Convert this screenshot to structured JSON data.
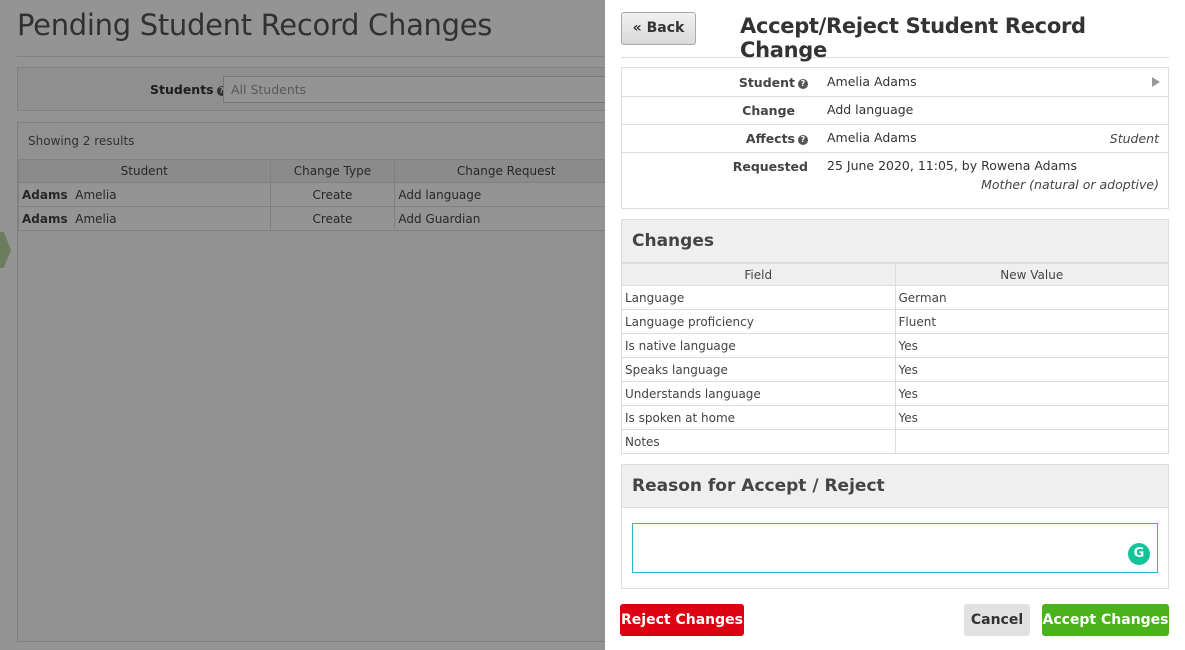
{
  "background": {
    "page_title": "Pending Student Record Changes",
    "filter": {
      "label": "Students",
      "placeholder": "All Students"
    },
    "results_count": "Showing 2 results",
    "table": {
      "headers": [
        "Student",
        "Change Type",
        "Change Request"
      ],
      "rows": [
        {
          "last": "Adams",
          "first": "Amelia",
          "type": "Create",
          "request": "Add language"
        },
        {
          "last": "Adams",
          "first": "Amelia",
          "type": "Create",
          "request": "Add Guardian"
        }
      ]
    }
  },
  "modal": {
    "back_label": "« Back",
    "title": "Accept/Reject Student Record Change",
    "info": {
      "student_label": "Student",
      "student_value": "Amelia Adams",
      "change_label": "Change",
      "change_value": "Add language",
      "affects_label": "Affects",
      "affects_value": "Amelia Adams",
      "affects_role": "Student",
      "requested_label": "Requested",
      "requested_value": "25 June 2020, 11:05, by Rowena Adams",
      "requested_relation": "Mother (natural or adoptive)"
    },
    "changes": {
      "heading": "Changes",
      "headers": [
        "Field",
        "New Value"
      ],
      "rows": [
        {
          "field": "Language",
          "value": "German"
        },
        {
          "field": "Language proficiency",
          "value": "Fluent"
        },
        {
          "field": "Is native language",
          "value": "Yes"
        },
        {
          "field": "Speaks language",
          "value": "Yes"
        },
        {
          "field": "Understands language",
          "value": "Yes"
        },
        {
          "field": "Is spoken at home",
          "value": "Yes"
        },
        {
          "field": "Notes",
          "value": ""
        }
      ]
    },
    "reason": {
      "heading": "Reason for Accept / Reject",
      "value": ""
    },
    "buttons": {
      "reject": "Reject Changes",
      "cancel": "Cancel",
      "accept": "Accept Changes"
    }
  }
}
